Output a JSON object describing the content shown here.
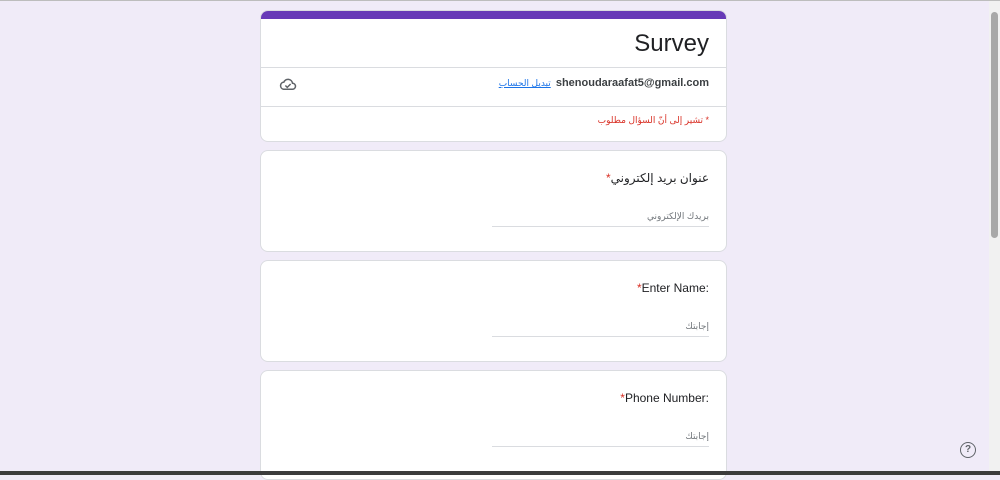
{
  "form": {
    "title": "Survey",
    "account_email": "shenoudaraafat5@gmail.com",
    "switch_account": "تبديل الحساب",
    "required_note": "* تشير إلى أنّ السؤال مطلوب"
  },
  "questions": [
    {
      "label": "عنوان بريد إلكتروني",
      "required_mark": "*",
      "placeholder": "بريدك الإلكتروني"
    },
    {
      "label": ":Enter Name",
      "required_mark": "*",
      "placeholder": "إجابتك"
    },
    {
      "label": ":Phone Number",
      "required_mark": "*",
      "placeholder": "إجابتك"
    }
  ],
  "help": {
    "symbol": "?"
  },
  "colors": {
    "accent": "#673ab7",
    "background": "#f0ebf8",
    "required": "#d93025",
    "link": "#1a73e8"
  }
}
